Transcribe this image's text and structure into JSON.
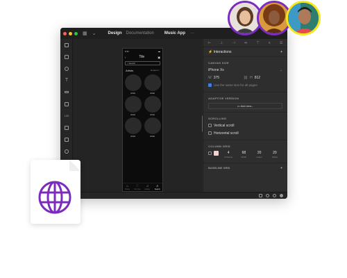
{
  "colors": {
    "accent": "#7b2cbf",
    "close": "#ff5f57",
    "minimize": "#febc2e",
    "maximize": "#28c840",
    "checkbox": "#3d7fe2"
  },
  "titlebar": {
    "tabs": [
      {
        "label": "Design"
      },
      {
        "label": "Documentation"
      }
    ],
    "document": "Music App",
    "more": "···"
  },
  "phone": {
    "time": "9:41",
    "title": "Tile",
    "search_placeholder": "Search",
    "section": "Artists",
    "expand": "Expand >",
    "artists": [
      "Artist",
      "Artist",
      "Artist",
      "Artist",
      "Artist",
      "Artist"
    ],
    "tabs": [
      {
        "label": "Home",
        "icon": "home-icon"
      },
      {
        "label": "For You",
        "icon": "heart-icon"
      },
      {
        "label": "Library",
        "icon": "music-icon"
      },
      {
        "label": "Search",
        "icon": "search-icon"
      }
    ]
  },
  "panel": {
    "interactions": "Interactions",
    "add": "+",
    "canvas_size": {
      "header": "CANVAS SIZE",
      "device": "iPhone Xs",
      "w_label": "W",
      "w": "375",
      "h_label": "H",
      "h": "812",
      "same_size": "Use the same size for all pages"
    },
    "adaptive": {
      "header": "ADAPTIVE VERSION",
      "button": "Add new..."
    },
    "scrolling": {
      "header": "SCROLLING",
      "vertical": "Vertical scroll",
      "horizontal": "Horizontal scroll"
    },
    "column_grid": {
      "header": "COLUMN GRID",
      "columns": "4",
      "columns_label": "Columns",
      "width": "68",
      "width_label": "Width",
      "gutter": "20",
      "gutter_label": "Gutter",
      "offset": "20",
      "offset_label": "Offset"
    },
    "baseline": {
      "header": "BASELINE GRID",
      "add": "+"
    }
  }
}
